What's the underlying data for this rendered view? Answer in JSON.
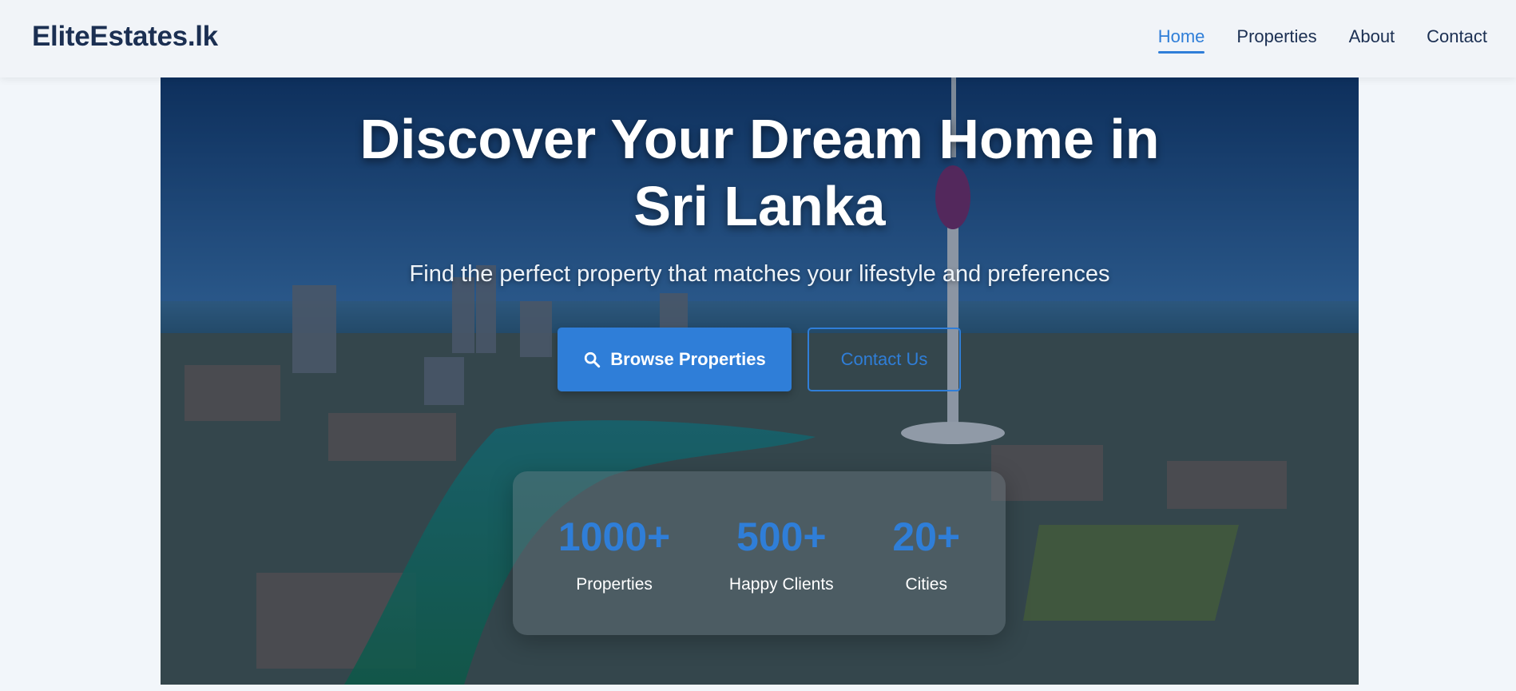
{
  "brand": {
    "logo": "EliteEstates.lk"
  },
  "nav": {
    "items": [
      {
        "label": "Home",
        "active": true
      },
      {
        "label": "Properties",
        "active": false
      },
      {
        "label": "About",
        "active": false
      },
      {
        "label": "Contact",
        "active": false
      }
    ]
  },
  "hero": {
    "title_line1": "Discover Your Dream Home in",
    "title_line2": "Sri Lanka",
    "subtitle": "Find the perfect property that matches your lifestyle and preferences",
    "primary_button": {
      "label": "Browse Properties",
      "icon": "search-icon"
    },
    "secondary_button": {
      "label": "Contact Us"
    }
  },
  "stats": [
    {
      "value": "1000+",
      "label": "Properties"
    },
    {
      "value": "500+",
      "label": "Happy Clients"
    },
    {
      "value": "20+",
      "label": "Cities"
    }
  ],
  "colors": {
    "accent": "#2f7ed8",
    "brand_text": "#1b2f52",
    "nav_background": "#f1f4f8"
  }
}
